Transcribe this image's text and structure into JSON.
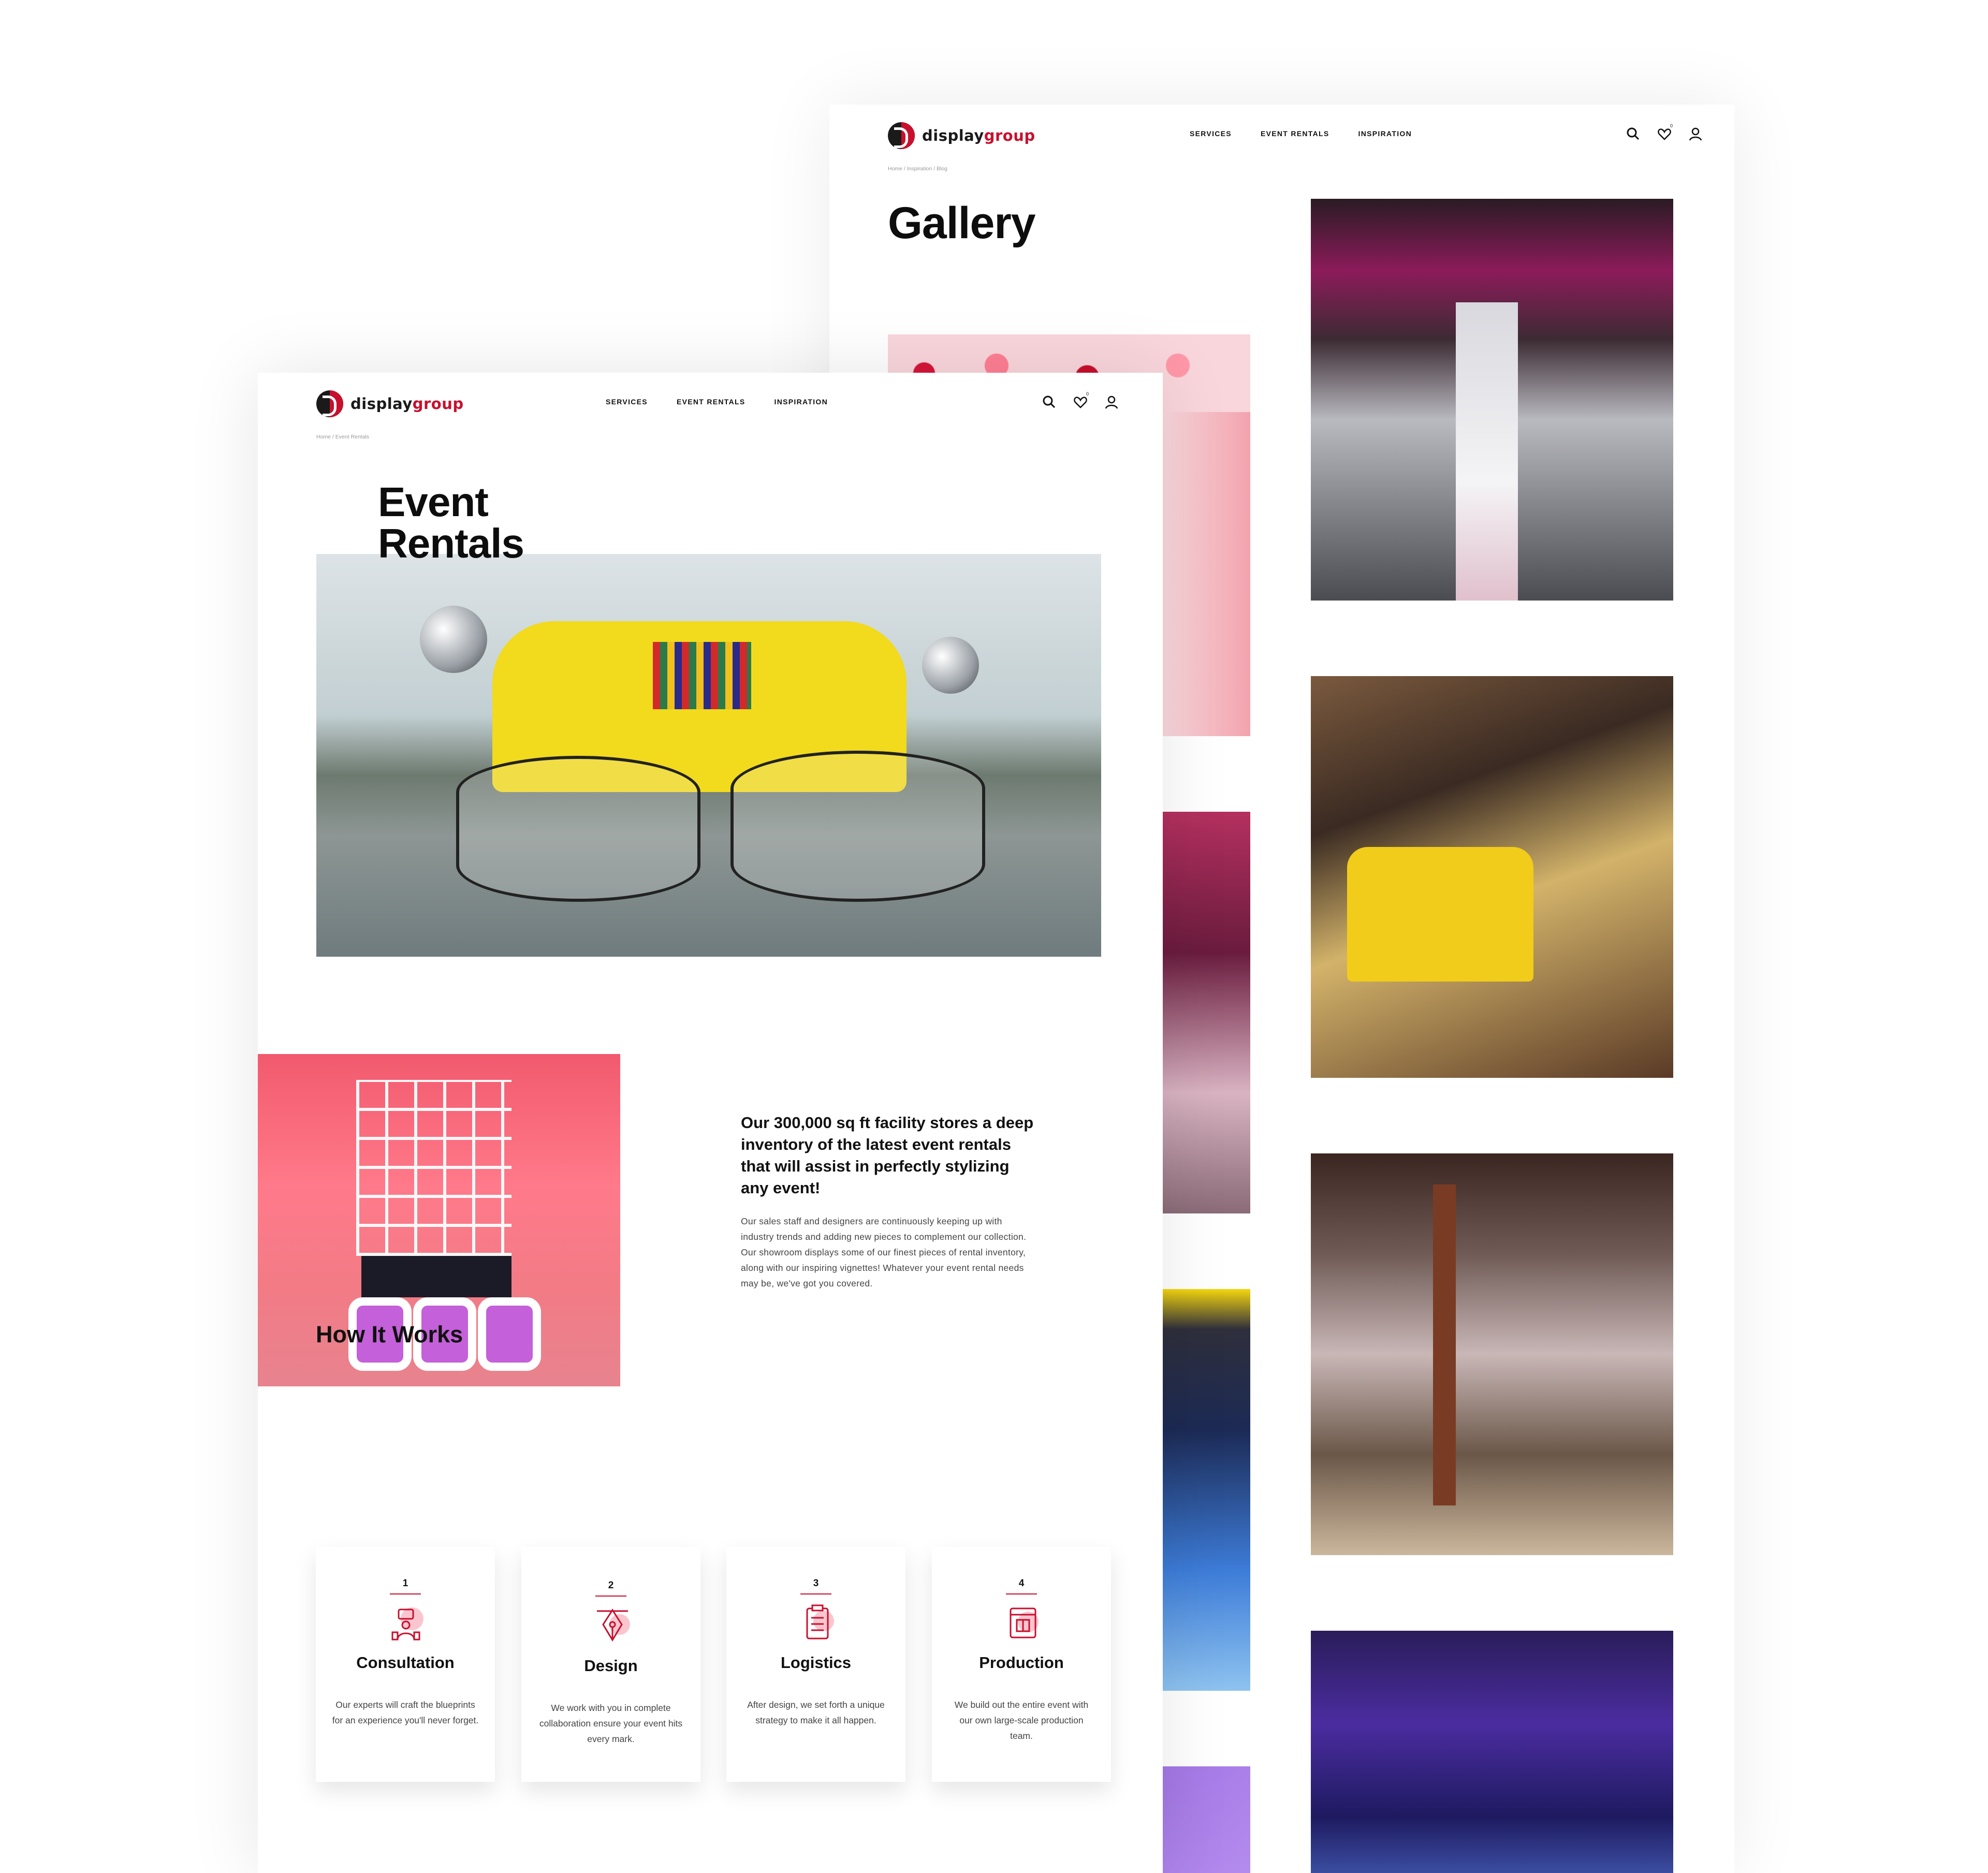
{
  "brand": {
    "part1": "display",
    "part2": "group"
  },
  "nav": [
    "SERVICES",
    "EVENT RENTALS",
    "INSPIRATION"
  ],
  "icons": {
    "search": "search-icon",
    "wishlist": "heart-icon",
    "account": "user-icon"
  },
  "wishlist_count": "0",
  "gallery_page": {
    "breadcrumb": "Home / Inspiration / Blog",
    "title": "Gallery"
  },
  "rentals_page": {
    "breadcrumb": "Home / Event Rentals",
    "title_line1": "Event",
    "title_line2": "Rentals",
    "lead": "Our 300,000 sq ft facility stores a deep inventory of the latest event rentals that will assist in perfectly stylizing any event!",
    "body": "Our sales staff and designers are continuously keeping up with industry trends and adding new pieces to complement our collection. Our showroom displays some of our finest pieces of rental inventory, along with our inspiring vignettes! Whatever your event rental needs may be, we've got you covered.",
    "how_title": "How It Works",
    "steps": [
      {
        "num": "1",
        "title": "Consultation",
        "text": "Our experts will craft the blueprints for an experience you'll never forget.",
        "icon": "consultation-icon"
      },
      {
        "num": "2",
        "title": "Design",
        "text": "We work with you in complete collaboration ensure your event hits every mark.",
        "icon": "pen-tool-icon"
      },
      {
        "num": "3",
        "title": "Logistics",
        "text": "After design, we set forth a unique strategy to make it all happen.",
        "icon": "clipboard-icon"
      },
      {
        "num": "4",
        "title": "Production",
        "text": "We build out the entire event with our own large-scale production team.",
        "icon": "production-icon"
      }
    ]
  },
  "colors": {
    "accent": "#c8102e",
    "ink": "#111111",
    "muted": "#999999"
  }
}
